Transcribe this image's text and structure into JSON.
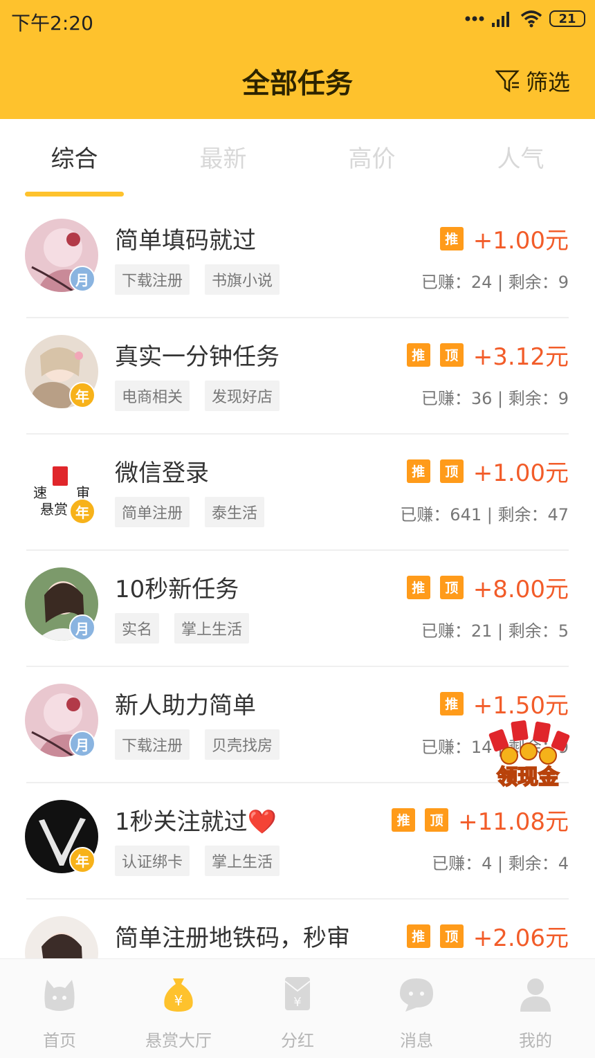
{
  "status_bar": {
    "time": "下午2:20",
    "battery": "21"
  },
  "header": {
    "title": "全部任务",
    "filter_label": "筛选"
  },
  "tabs": [
    {
      "label": "综合",
      "active": true
    },
    {
      "label": "最新",
      "active": false
    },
    {
      "label": "高价",
      "active": false
    },
    {
      "label": "人气",
      "active": false
    }
  ],
  "chips": {
    "recommend": "推",
    "top": "顶"
  },
  "tasks": [
    {
      "title": "简单填码就过",
      "badge": "月",
      "tags": [
        "下载注册",
        "书旗小说"
      ],
      "price": "+1.00元",
      "recommend": true,
      "pinned": false,
      "stats": "已赚：24 | 剩余：9"
    },
    {
      "title": "真实一分钟任务",
      "badge": "年",
      "tags": [
        "电商相关",
        "发现好店"
      ],
      "price": "+3.12元",
      "recommend": true,
      "pinned": true,
      "stats": "已赚：36 | 剩余：9"
    },
    {
      "title": "微信登录",
      "badge": "年",
      "tags": [
        "简单注册",
        "泰生活"
      ],
      "price": "+1.00元",
      "recommend": true,
      "pinned": true,
      "stats": "已赚：641 | 剩余：47",
      "avatar_text": [
        "速",
        "审",
        "悬赏"
      ]
    },
    {
      "title": "10秒新任务",
      "badge": "月",
      "tags": [
        "实名",
        "掌上生活"
      ],
      "price": "+8.00元",
      "recommend": true,
      "pinned": true,
      "stats": "已赚：21 | 剩余：5"
    },
    {
      "title": "新人助力简单",
      "badge": "月",
      "tags": [
        "下载注册",
        "贝壳找房"
      ],
      "price": "+1.50元",
      "recommend": true,
      "pinned": false,
      "stats": "已赚：14 | 剩余：9"
    },
    {
      "title": "1秒关注就过❤️",
      "badge": "年",
      "tags": [
        "认证绑卡",
        "掌上生活"
      ],
      "price": "+11.08元",
      "recommend": true,
      "pinned": true,
      "stats": "已赚：4 | 剩余：4"
    },
    {
      "title": "简单注册地铁码，秒审",
      "badge": "",
      "tags": [],
      "price": "+2.06元",
      "recommend": true,
      "pinned": true,
      "stats": ""
    }
  ],
  "promo": {
    "label": "领现金"
  },
  "bottom_nav": [
    {
      "label": "首页",
      "icon": "home-icon",
      "active": false
    },
    {
      "label": "悬赏大厅",
      "icon": "money-bag-icon",
      "active": true
    },
    {
      "label": "分红",
      "icon": "red-envelope-icon",
      "active": false
    },
    {
      "label": "消息",
      "icon": "chat-icon",
      "active": false
    },
    {
      "label": "我的",
      "icon": "user-icon",
      "active": false
    }
  ],
  "colors": {
    "brand": "#fec22d",
    "price": "#f25c29",
    "chip": "#ff9b1a"
  }
}
